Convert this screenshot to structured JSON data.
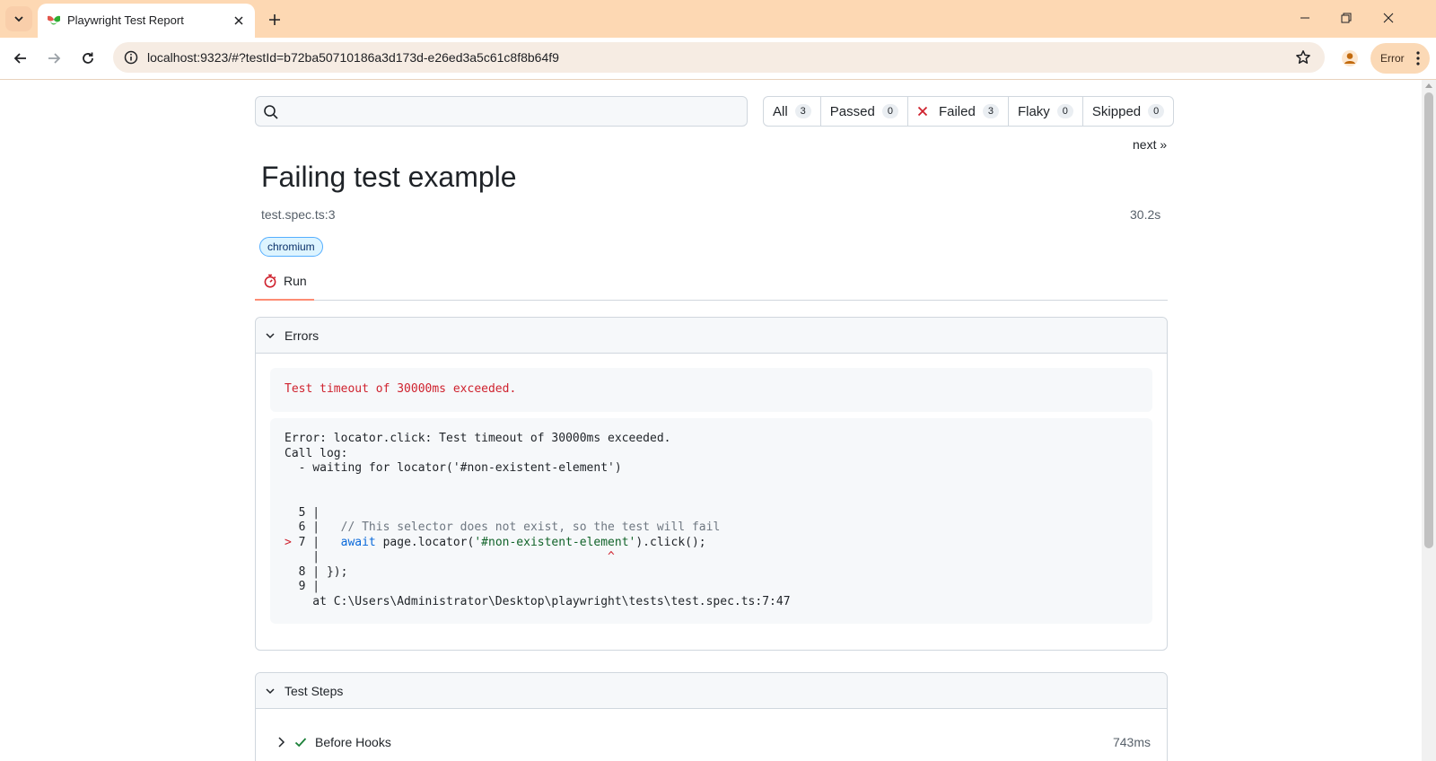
{
  "browser": {
    "tab_title": "Playwright Test Report",
    "url": "localhost:9323/#?testId=b72ba50710186a3d173d-e26ed3a5c61c8f8b64f9",
    "profile_status": "Error"
  },
  "report": {
    "search_placeholder": "",
    "filters": [
      {
        "label": "All",
        "count": "3"
      },
      {
        "label": "Passed",
        "count": "0"
      },
      {
        "label": "Failed",
        "count": "3"
      },
      {
        "label": "Flaky",
        "count": "0"
      },
      {
        "label": "Skipped",
        "count": "0"
      }
    ],
    "next_link": "next »",
    "test": {
      "title": "Failing test example",
      "location": "test.spec.ts:3",
      "duration": "30.2s",
      "project": "chromium"
    },
    "run_tab": "Run",
    "errors": {
      "heading": "Errors",
      "message": "Test timeout of 30000ms exceeded.",
      "stack": {
        "line1": "Error: locator.click: Test timeout of 30000ms exceeded.",
        "line2": "Call log:",
        "line3": "  - waiting for locator('#non-existent-element')",
        "code_5": "  5 |",
        "code_6_prefix": "  6 |   ",
        "code_6_comment": "// This selector does not exist, so the test will fail",
        "code_7_marker": "> ",
        "code_7_prefix": "7 |   ",
        "code_7_kw": "await",
        "code_7_mid": " page.locator(",
        "code_7_str": "'#non-existent-element'",
        "code_7_end": ").click();",
        "code_caret_prefix": "    |                                         ",
        "code_caret": "^",
        "code_8": "  8 | });",
        "code_9": "  9 |",
        "at_line": "    at C:\\Users\\Administrator\\Desktop\\playwright\\tests\\test.spec.ts:7:47"
      }
    },
    "steps": {
      "heading": "Test Steps",
      "items": [
        {
          "label": "Before Hooks",
          "duration": "743ms"
        }
      ]
    }
  },
  "colors": {
    "tabstrip": "#fdd8b3",
    "failed_icon": "#cf222e",
    "pass_icon": "#1a7f37",
    "run_tab_accent": "#fd8c73"
  }
}
